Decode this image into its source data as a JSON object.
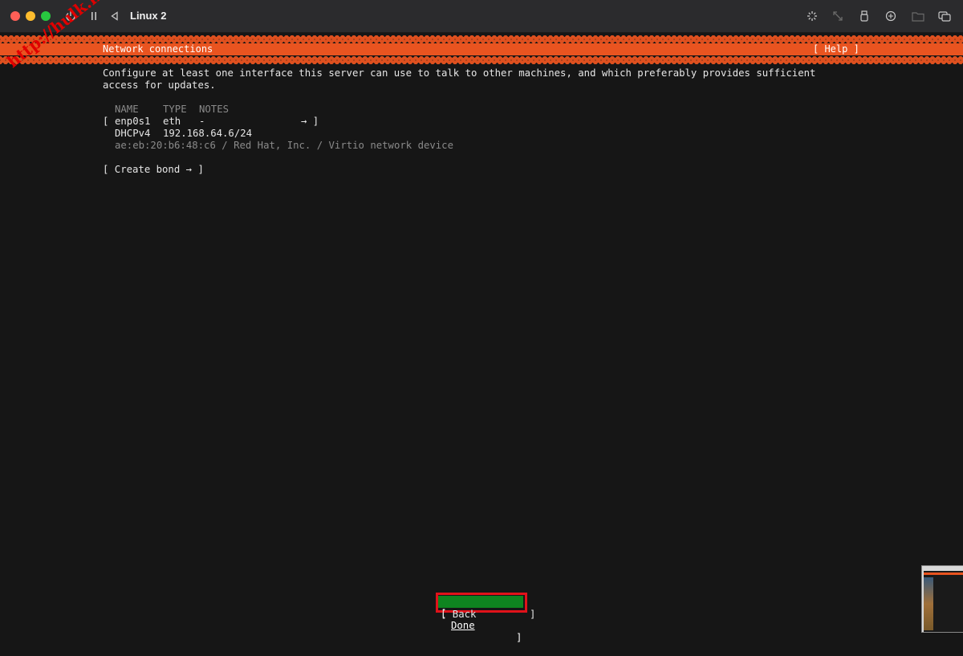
{
  "window": {
    "title": "Linux 2",
    "controls": [
      "power-icon",
      "pause-icon",
      "back-icon"
    ],
    "toolbar_icons": [
      "brightness-icon",
      "resize-icon",
      "usb-icon",
      "network-share-icon",
      "folder-icon",
      "windows-icon"
    ]
  },
  "header": {
    "title": "Network connections",
    "help": "[ Help ]"
  },
  "intro": {
    "line1": "Configure at least one interface this server can use to talk to other machines, and which preferably provides sufficient",
    "line2": "access for updates."
  },
  "table": {
    "columns": [
      "NAME",
      "TYPE",
      "NOTES"
    ],
    "interface": {
      "open_bracket": "[",
      "name": "enp0s1",
      "type": "eth",
      "notes": "-",
      "arrow": "→ ]",
      "dhcp_label": "DHCPv4",
      "address": "192.168.64.6/24",
      "details": "ae:eb:20:b6:48:c6 / Red Hat, Inc. / Virtio network device"
    }
  },
  "create_bond": "[ Create bond → ]",
  "buttons": {
    "done_open": "[",
    "done": "Done",
    "done_close": "]",
    "back": "[ Back         ]"
  },
  "watermark": "http://hulk.ki",
  "colors": {
    "accent": "#e95420",
    "done_bg": "#0e8420",
    "highlight": "#e0121a"
  }
}
